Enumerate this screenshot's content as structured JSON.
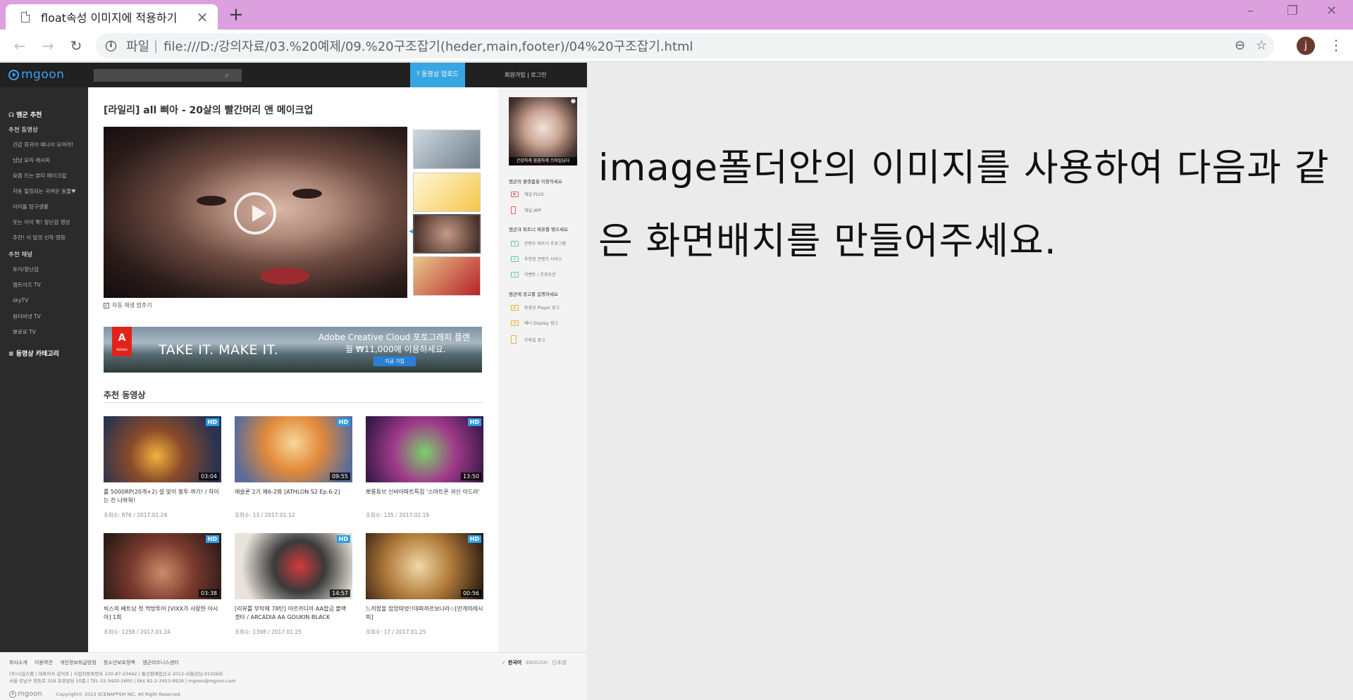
{
  "browser": {
    "tab_title": "float속성 이미지에 적용하기",
    "url_scheme": "파일",
    "url": "file:///D:/강의자료/03.%20예제/09.%20구조잡기(heder,main,footer)/04%20구조잡기.html",
    "profile_initial": "j",
    "icons": [
      "document-icon",
      "close-icon",
      "plus-icon",
      "back-arrow-icon",
      "forward-arrow-icon",
      "reload-icon",
      "info-icon",
      "zoom-out-icon",
      "star-icon",
      "menu-dots-icon",
      "minimize-icon",
      "restore-icon",
      "window-close-icon"
    ]
  },
  "site": {
    "header": {
      "logo": "mgoon",
      "upload_button": "동영상 업로드",
      "auth_links": "회원가입 | 로그인"
    },
    "sidebar": {
      "top_heading": "엠군 추천",
      "videos_heading": "추천 동영상",
      "video_items": [
        "건강 회귀아 매니아 모여라!",
        "냠냠 요리 레시피",
        "요즘 뜨는 뷰티 메이크업",
        "자동 힐링되는 귀여운 동물♥",
        "아이돌 탐구생활",
        "웃는 아이 톡! 장난감 영상",
        "추천! 이 달의 신작 영화"
      ],
      "channels_heading": "추천 채널",
      "channel_items": [
        "토이/장난감",
        "엠트이즈 TV",
        "skyTV",
        "원티비넷 TV",
        "뽀로로 TV"
      ],
      "category_heading": "동영상 카테고리"
    },
    "main": {
      "video_title": "[라일리] all 삐아 - 20살의 빨간머리 앤 메이크업",
      "autoplay_label": "자동 재생 멈추기",
      "ad": {
        "brand": "Adobe",
        "tagline": "TAKE IT. MAKE IT.",
        "headline": "Adobe Creative Cloud 포토그래피 플랜",
        "subline": "월 ₩11,000에 이용하세요.",
        "button": "지금 가입"
      },
      "section_title": "추천 동영상",
      "cards": [
        {
          "badge": "HD",
          "duration": "03:04",
          "title": "롤 5000RP(20개+2) 설 맞이 봉투 까기! / 하이는 진 나와워!",
          "meta": "조회수: 876  / 2017.01.24",
          "color": "#3b4a6b"
        },
        {
          "badge": "HD",
          "duration": "09:55",
          "title": "애슬론 2기 제6-2화 [ATHLON S2 Ep.6-2]",
          "meta": "조회수: 13  / 2017.01.12",
          "color": "#e9a23b"
        },
        {
          "badge": "HD",
          "duration": "13:50",
          "title": "뽀롱튜브 신비아파트특집 '스마트폰 귀신 이드라'",
          "meta": "조회수: 135  / 2017.01.19",
          "color": "#6b2f7a"
        },
        {
          "badge": "HD",
          "duration": "03:38",
          "title": "빅스의 베트남 첫 먹방투어 [VIXX가 사랑한 아시아] 1회",
          "meta": "조회수: 1258  / 2017.01.24",
          "color": "#6f3b32"
        },
        {
          "badge": "HD",
          "duration": "14:57",
          "title": "[리뷰를 부탁해 78탄] 아르카디아 AA합금 블랙 겟타 / ARCADIA AA GOUKIN BLACK",
          "meta": "조회수: 1398  / 2017.01.25",
          "color": "#c9c3b6"
        },
        {
          "badge": "HD",
          "duration": "00:56",
          "title": "느끼함을 잡았따엇!!대파까르보나라☆[만개의레시피]",
          "meta": "조회수: 17  / 2017.01.25",
          "color": "#8a6a3c"
        }
      ]
    },
    "rail": {
      "ad_caption": "건강하게 꼼꼼하게 스타일닙다",
      "groups": [
        {
          "heading": "엠군의 플랫폼을 이용하세요",
          "items": [
            "채널 PLUS",
            "채널 APP"
          ]
        },
        {
          "heading": "엠군과 파트너 제휴를 맺으세요",
          "items": [
            "콘텐츠 파트너 프로그램",
            "추천형 콘텐츠 서비스",
            "이벤트 / 프로모션"
          ]
        },
        {
          "heading": "엠군에 광고를 집행하세요",
          "items": [
            "동영상 Player 광고",
            "배너 Display 광고",
            "모바일 광고"
          ]
        }
      ]
    },
    "footer": {
      "links": [
        "회사소개",
        "이용약관",
        "개인정보취급방침",
        "청소년보호정책",
        "엠군비즈니스센터"
      ],
      "languages": [
        "한국어",
        "ENGLISH",
        "日本語"
      ],
      "info_line1": "(주)시냅스엠 | 대표이사 김덕조 | 사업자등록번호 220-87-23442 | 통신판매업신고 2012-서울강남-01326호",
      "info_line2": "서울 강남구 학동로 318 유경빌딩 10층 | TEL 02-3420-1600 | FAX 82-2-3453-9928  |  mgoon@mgoon.com",
      "copyright": "Copyright© 2013 SCENAPPSM INC. All Right Reserved."
    }
  },
  "instruction": "image폴더안의 이미지를 사용하여 다음과 같은 화면배치를 만들어주세요."
}
